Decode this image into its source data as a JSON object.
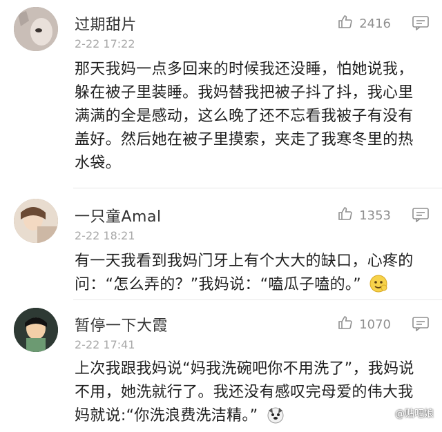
{
  "comments": [
    {
      "username": "过期甜片",
      "timestamp": "2-22 17:22",
      "likes": "2416",
      "text_lines": [
        "那天我妈一点多回来的时候我还没睡，怕她说我，",
        "躲在被子里装睡。我妈替我把被子抖了抖，我心里",
        "满满的全是感动，这么晚了还不忘看我被子有没有",
        "盖好。然后她在被子里摸索，夹走了我寒冬里的热",
        "水袋。"
      ]
    },
    {
      "username": "一只童Amal",
      "timestamp": "2-22 18:21",
      "likes": "1353",
      "text_lines": [
        "有一天我看到我妈门牙上有个大大的缺口，心疼的",
        "问：“怎么弄的？”我妈说：“嗑瓜子嗑的。”"
      ]
    },
    {
      "username": "暂停一下大霞",
      "timestamp": "2-22 17:41",
      "likes": "1070",
      "text_lines": [
        "上次我跟我妈说“妈我洗碗吧你不用洗了”，我妈说",
        "不用，她洗就行了。我还没有感叹完母爱的伟大我",
        "妈就说:“你洗浪费洗洁精。”"
      ]
    }
  ],
  "icons": {
    "like": "thumbs-up-icon",
    "comment": "comment-icon",
    "emoji_1": "smiling-face-icon",
    "emoji_2": "dog-face-icon"
  },
  "watermark": "@贴吧娘",
  "colors": {
    "username": "#333333",
    "timestamp": "#a7a7a7",
    "body_text": "#1f1f1f",
    "like_text": "#8f8f8f",
    "divider": "#e6e6e6"
  }
}
